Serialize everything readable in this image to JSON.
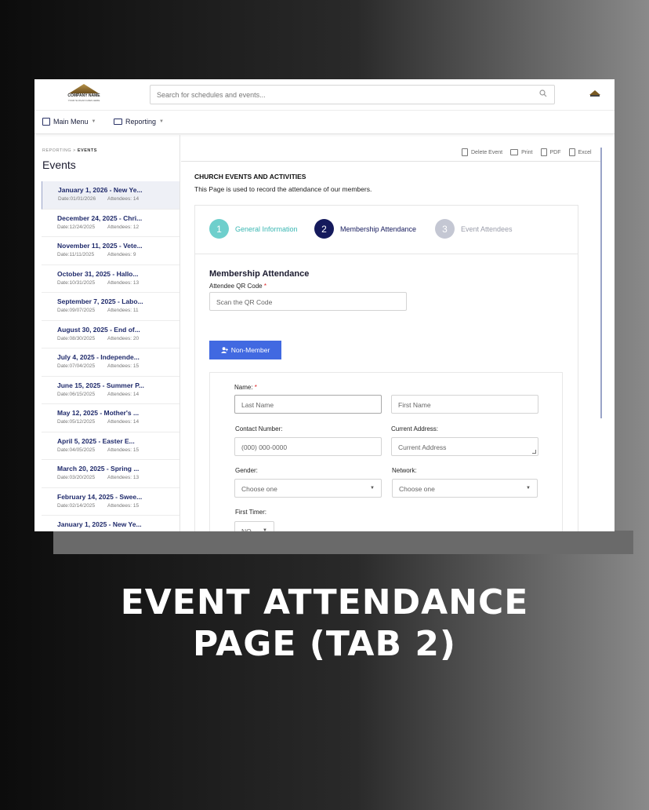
{
  "header": {
    "logo_name": "COMPANY NAME",
    "logo_tagline": "YOUR SLOGAN GOES HERE",
    "search_placeholder": "Search for schedules and events..."
  },
  "menu": {
    "main_menu": "Main Menu",
    "reporting": "Reporting"
  },
  "sidebar": {
    "breadcrumb_root": "REPORTING",
    "breadcrumb_sep": ">",
    "breadcrumb_current": "EVENTS",
    "title": "Events",
    "events": [
      {
        "title": "January 1, 2026 - New Ye...",
        "date": "Date:01/01/2026",
        "attendees": "Attendees: 14"
      },
      {
        "title": "December 24, 2025 - Chri...",
        "date": "Date:12/24/2025",
        "attendees": "Attendees: 12"
      },
      {
        "title": "November 11, 2025 - Vete...",
        "date": "Date:11/11/2025",
        "attendees": "Attendees: 9"
      },
      {
        "title": "October 31, 2025 - Hallo...",
        "date": "Date:10/31/2025",
        "attendees": "Attendees: 13"
      },
      {
        "title": "September 7, 2025 - Labo...",
        "date": "Date:09/07/2025",
        "attendees": "Attendees: 11"
      },
      {
        "title": "August 30, 2025 - End of...",
        "date": "Date:08/30/2025",
        "attendees": "Attendees: 20"
      },
      {
        "title": "July 4, 2025 - Independe...",
        "date": "Date:07/04/2025",
        "attendees": "Attendees: 15"
      },
      {
        "title": "June 15, 2025 - Summer P...",
        "date": "Date:06/15/2025",
        "attendees": "Attendees: 14"
      },
      {
        "title": "May 12, 2025 - Mother's ...",
        "date": "Date:05/12/2025",
        "attendees": "Attendees: 14"
      },
      {
        "title": "April 5, 2025 - Easter E...",
        "date": "Date:04/05/2025",
        "attendees": "Attendees: 15"
      },
      {
        "title": "March 20, 2025 - Spring ...",
        "date": "Date:03/20/2025",
        "attendees": "Attendees: 13"
      },
      {
        "title": "February 14, 2025 - Swee...",
        "date": "Date:02/14/2025",
        "attendees": "Attendees: 15"
      },
      {
        "title": "January 1, 2025 - New Ye...",
        "date": "",
        "attendees": ""
      }
    ]
  },
  "toolbar": {
    "delete": "Delete Event",
    "print": "Print",
    "pdf": "PDF",
    "excel": "Excel"
  },
  "page": {
    "heading": "CHURCH EVENTS AND ACTIVITIES",
    "description": "This Page is used to record the attendance of our members."
  },
  "steps": [
    {
      "number": "1",
      "label": "General Information"
    },
    {
      "number": "2",
      "label": "Membership Attendance"
    },
    {
      "number": "3",
      "label": "Event Attendees"
    }
  ],
  "form": {
    "section_title": "Membership Attendance",
    "qr_label": "Attendee QR Code",
    "qr_placeholder": "Scan the QR Code",
    "non_member_button": "Non-Member",
    "name_label": "Name:",
    "last_name_placeholder": "Last Name",
    "first_name_placeholder": "First Name",
    "contact_label": "Contact Number:",
    "contact_placeholder": "(000) 000-0000",
    "address_label": "Current Address:",
    "address_placeholder": "Current Address",
    "gender_label": "Gender:",
    "gender_value": "Choose one",
    "network_label": "Network:",
    "network_value": "Choose one",
    "first_timer_label": "First Timer:",
    "first_timer_value": "NO",
    "required_mark": "*"
  },
  "caption": {
    "line1": "EVENT ATTENDANCE",
    "line2": "PAGE (TAB 2)"
  },
  "colors": {
    "accent": "#4169e1",
    "step_done": "#6ecfcc",
    "step_active": "#151a5c",
    "step_pending": "#c4c7d3"
  }
}
